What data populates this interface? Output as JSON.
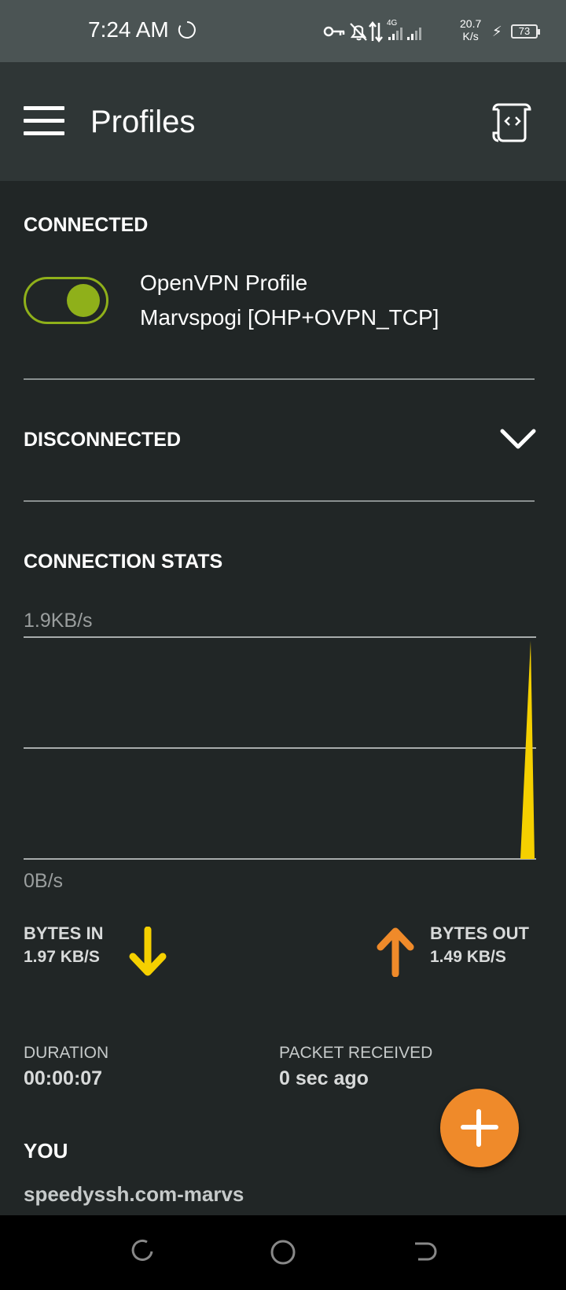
{
  "status_bar": {
    "time": "7:24 AM",
    "network_type": "4G",
    "speed_value": "20.7",
    "speed_unit": "K/s",
    "battery": "73",
    "icons": [
      "sync-icon",
      "vpn-key-icon",
      "notifications-off-icon",
      "data-transfer-icon",
      "signal-icon",
      "signal-icon-2",
      "charging-icon",
      "battery-icon"
    ]
  },
  "app_bar": {
    "title": "Profiles",
    "menu_icon": "menu-icon",
    "action_icon": "import-profile-icon"
  },
  "connected": {
    "header": "CONNECTED",
    "profile_type": "OpenVPN Profile",
    "profile_name": "Marvspogi [OHP+OVPN_TCP]",
    "toggle_on": true,
    "toggle_color": "#8fb01a"
  },
  "disconnected": {
    "header": "DISCONNECTED"
  },
  "stats": {
    "header": "CONNECTION STATS",
    "bytes_in_label": "BYTES IN",
    "bytes_in_value": "1.97 KB/S",
    "bytes_out_label": "BYTES OUT",
    "bytes_out_value": "1.49 KB/S",
    "in_color": "#f5d000",
    "out_color": "#ef8a2a",
    "duration_label": "DURATION",
    "duration_value": "00:00:07",
    "packet_label": "PACKET RECEIVED",
    "packet_value": "0 sec ago"
  },
  "chart_data": {
    "type": "area",
    "title": "",
    "xlabel": "",
    "ylabel": "",
    "y_max_label": "1.9KB/s",
    "y_min_label": "0B/s",
    "ylim": [
      0,
      1.9
    ],
    "y_unit": "KB/s",
    "grid": true,
    "series": [
      {
        "color": "#f5d000",
        "values": [
          0,
          0,
          0,
          0,
          0,
          0,
          0,
          0,
          0,
          0,
          0,
          0,
          0,
          0,
          0,
          0,
          0,
          0,
          0,
          0,
          0,
          0,
          0,
          0,
          0,
          0,
          0,
          0,
          0,
          0,
          0,
          0,
          0,
          0,
          0,
          0,
          0,
          0,
          0,
          0,
          0,
          0,
          0,
          0,
          0,
          0,
          0,
          0,
          0,
          0,
          0,
          0,
          0,
          0,
          0,
          0,
          0,
          0,
          0,
          0,
          0,
          0,
          0,
          0,
          0,
          0,
          0,
          0,
          0,
          0,
          0,
          0,
          0,
          0,
          0,
          0,
          0,
          0,
          0,
          0,
          0,
          0,
          0,
          0,
          0,
          0,
          0,
          0,
          0,
          0,
          0,
          0,
          0,
          0,
          0,
          0,
          0,
          0,
          0,
          1.87
        ]
      }
    ]
  },
  "you": {
    "header": "YOU",
    "value": "speedyssh.com-marvs"
  },
  "fab": {
    "icon": "add-icon",
    "color": "#ef8a2a"
  },
  "nav_bar": {
    "icons": [
      "recent-apps-icon",
      "home-icon",
      "back-icon"
    ]
  }
}
